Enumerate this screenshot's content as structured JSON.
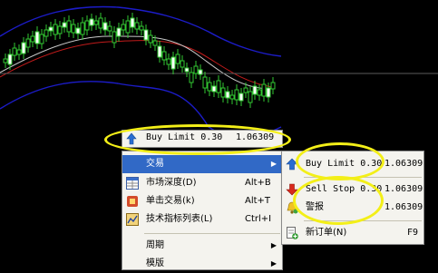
{
  "chart_window": {
    "background": "#000000",
    "price_line": "#5d5d5d"
  },
  "pending_order_row": {
    "label": "Buy Limit 0.30",
    "price": "1.06309"
  },
  "context_menu": {
    "items": [
      {
        "label": "交易",
        "shortcut": "",
        "submenu": true,
        "highlighted": true,
        "icon": "none"
      },
      {
        "label": "市场深度(D)",
        "shortcut": "Alt+B",
        "submenu": false,
        "icon": "market-depth-icon"
      },
      {
        "label": "单击交易(k)",
        "shortcut": "Alt+T",
        "submenu": false,
        "icon": "one-click-icon"
      },
      {
        "label": "技术指标列表(L)",
        "shortcut": "Ctrl+I",
        "submenu": false,
        "icon": "indicators-icon"
      },
      {
        "label": "周期",
        "shortcut": "",
        "submenu": true,
        "icon": "none"
      },
      {
        "label": "模版",
        "shortcut": "",
        "submenu": true,
        "icon": "none"
      }
    ]
  },
  "trade_submenu": {
    "items": [
      {
        "label": "Buy Limit 0.30",
        "price": "1.06309",
        "icon": "arrow-up-icon"
      },
      {
        "label": "Sell Stop 0.30",
        "price": "1.06309",
        "icon": "arrow-down-icon"
      },
      {
        "label": "警报",
        "price": "1.06309",
        "icon": "alarm-bell-icon"
      },
      {
        "label": "新订单(N)",
        "price": "F9",
        "icon": "new-order-icon"
      }
    ]
  },
  "highlight_color": "#f3ef18",
  "menu_highlight_color": "#3169c6"
}
